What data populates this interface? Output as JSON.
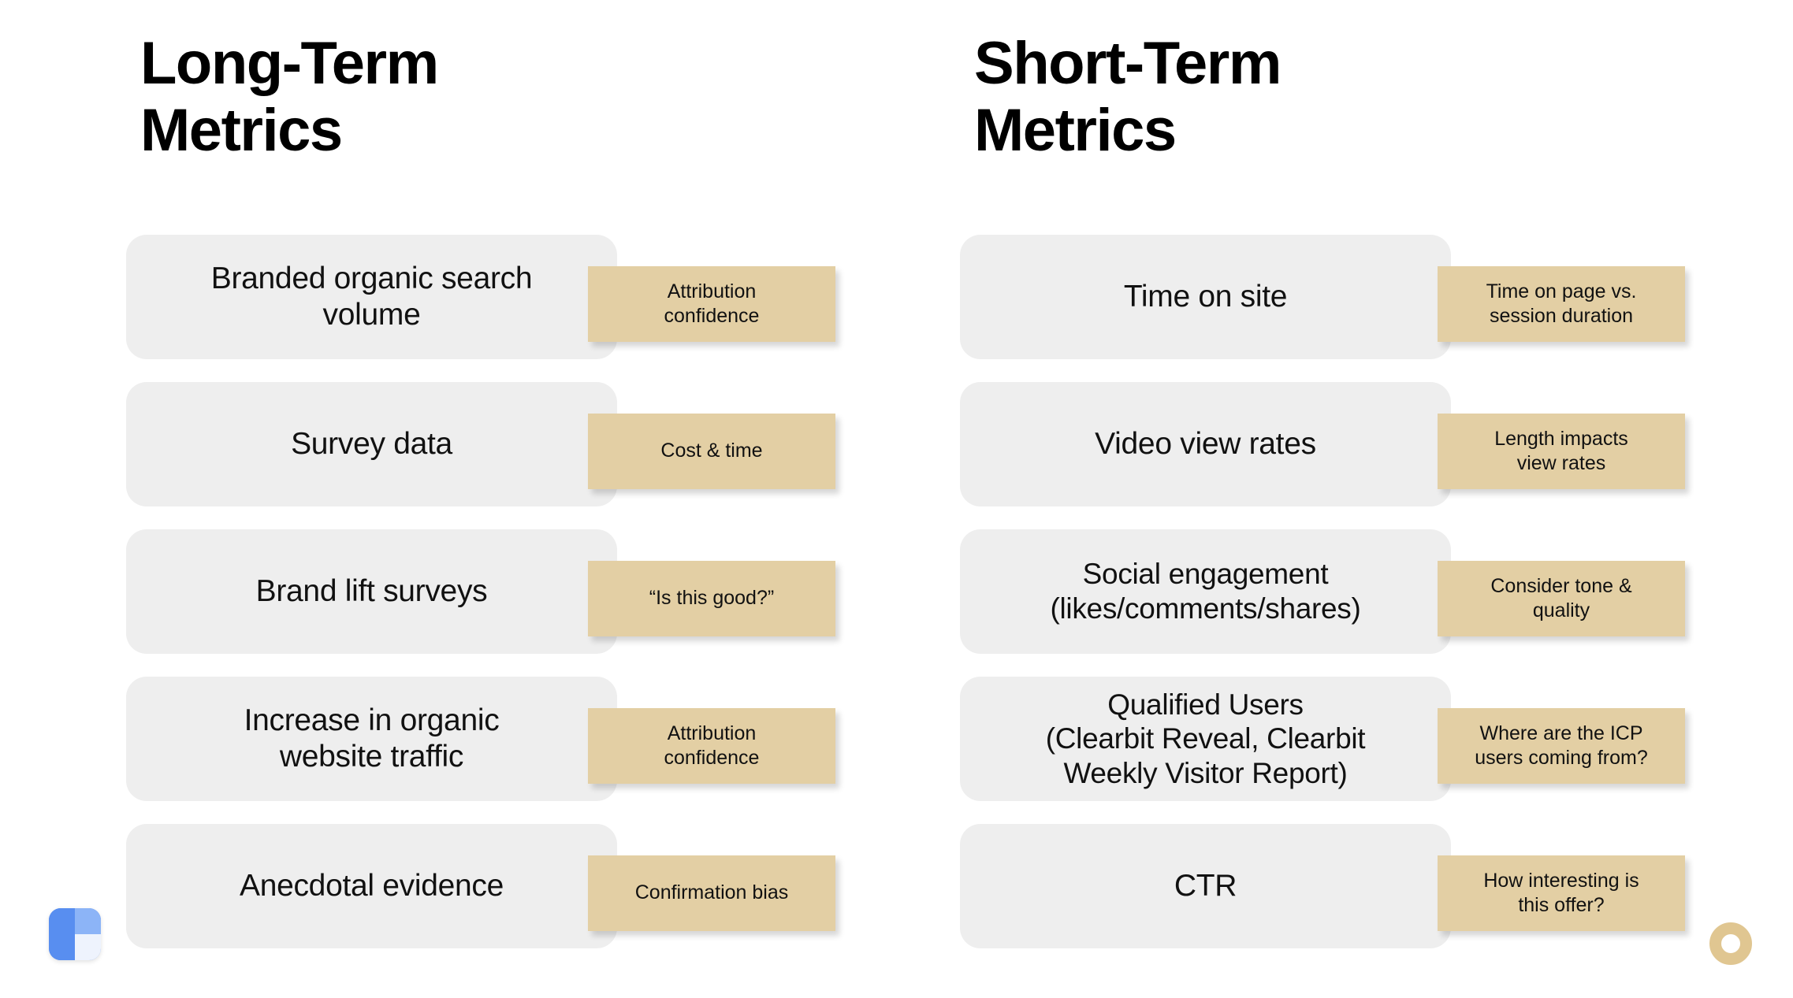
{
  "page": {
    "background": "#ffffff",
    "card_color": "#eeeeee",
    "tag_color": "#e3cfa4",
    "text_color": "#111111"
  },
  "columns": [
    {
      "title": "Long-Term\nMetrics",
      "rows": [
        {
          "metric": "Branded organic search\nvolume",
          "note": "Attribution\nconfidence"
        },
        {
          "metric": "Survey data",
          "note": "Cost & time"
        },
        {
          "metric": "Brand lift surveys",
          "note": "“Is this good?”"
        },
        {
          "metric": "Increase in organic\nwebsite traffic",
          "note": "Attribution\nconfidence"
        },
        {
          "metric": "Anecdotal evidence",
          "note": "Confirmation bias"
        }
      ]
    },
    {
      "title": "Short-Term\nMetrics",
      "rows": [
        {
          "metric": "Time on site",
          "note": "Time on page vs.\nsession duration"
        },
        {
          "metric": "Video view rates",
          "note": "Length impacts\nview rates"
        },
        {
          "metric": "Social engagement\n(likes/comments/shares)",
          "note": "Consider tone &\nquality"
        },
        {
          "metric": "Qualified Users\n(Clearbit Reveal, Clearbit\nWeekly Visitor Report)",
          "note": "Where are the ICP\nusers coming from?"
        },
        {
          "metric": "CTR",
          "note": "How interesting is\nthis offer?"
        }
      ]
    }
  ],
  "marks": {
    "logo": "app-logo-icon",
    "ring": "ring-icon"
  }
}
